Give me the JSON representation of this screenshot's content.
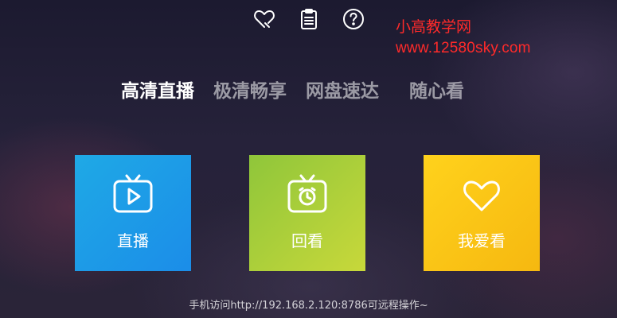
{
  "top_icons": [
    {
      "name": "heart-edit-icon"
    },
    {
      "name": "clipboard-icon"
    },
    {
      "name": "help-icon"
    }
  ],
  "watermark": {
    "name": "小高教学网",
    "url": "www.12580sky.com",
    "color": "#ff2a2a"
  },
  "tabs": [
    {
      "label": "高清直播",
      "active": true
    },
    {
      "label": "极清畅享",
      "active": false
    },
    {
      "label": "网盘速达",
      "active": false
    },
    {
      "label": "随心看",
      "active": false
    }
  ],
  "tiles": [
    {
      "label": "直播",
      "icon": "tv-play-icon",
      "color": "#1b9be7"
    },
    {
      "label": "回看",
      "icon": "tv-clock-icon",
      "color": "#a9cf3a"
    },
    {
      "label": "我爱看",
      "icon": "heart-icon",
      "color": "#fbc516"
    }
  ],
  "footer": {
    "text": "手机访问http://192.168.2.120:8786可远程操作~"
  }
}
